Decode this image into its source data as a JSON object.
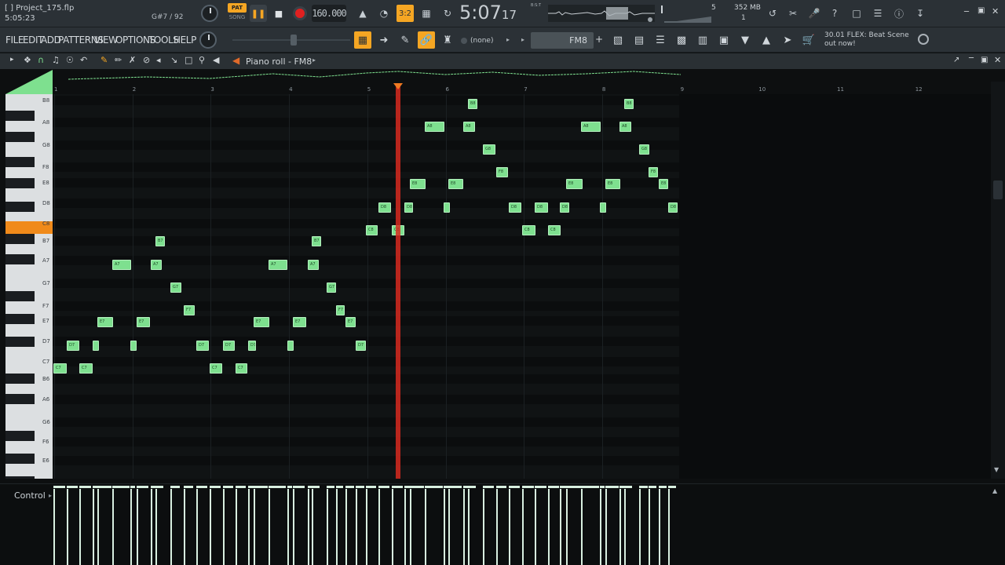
{
  "window": {
    "project_file": "[ ] Project_175.flp",
    "elapsed": "5:05:23",
    "note_info": "G#7 / 92"
  },
  "transport": {
    "pat_label": "PAT",
    "song_label": "SONG",
    "tempo": "160.000",
    "time_main": "5:07",
    "time_sub": "17",
    "time_unit": "B:S:T",
    "snap_label": "3:2",
    "cpu_voices": "5",
    "memory": "352 MB",
    "poly": "1"
  },
  "menu": [
    "FILE",
    "EDIT",
    "ADD",
    "PATTERNS",
    "VIEW",
    "OPTIONS",
    "TOOLS",
    "HELP"
  ],
  "toolbar": {
    "pattern_select": "(none)",
    "channel_name": "FM8",
    "news_line1": "30.01  FLEX: Beat Scene",
    "news_line2": "out now!"
  },
  "piano_roll": {
    "title": "Piano roll - FM8",
    "control_label": "Control",
    "bar_numbers": [
      "1",
      "2",
      "3",
      "4",
      "5",
      "6",
      "7",
      "8",
      "9",
      "10",
      "11",
      "12"
    ],
    "key_labels": [
      "B8",
      "A8",
      "G8",
      "F8",
      "E8",
      "D8",
      "C8",
      "B7",
      "A7",
      "G7",
      "F7",
      "E7",
      "D7",
      "C7",
      "B6",
      "A6",
      "G6",
      "F6",
      "E6"
    ],
    "notes": [
      {
        "label": "C7"
      },
      {
        "label": "C7"
      },
      {
        "label": "D7"
      },
      {
        "label": ""
      },
      {
        "label": "E7"
      },
      {
        "label": "A7"
      },
      {
        "label": "E7"
      },
      {
        "label": ""
      },
      {
        "label": "B7"
      },
      {
        "label": "A7"
      },
      {
        "label": "G7"
      },
      {
        "label": "F7"
      },
      {
        "label": "D7"
      },
      {
        "label": "C7"
      },
      {
        "label": "D7"
      },
      {
        "label": "C7"
      },
      {
        "label": "D7"
      },
      {
        "label": "E7"
      },
      {
        "label": "A7"
      },
      {
        "label": ""
      },
      {
        "label": "E7"
      },
      {
        "label": "A7"
      },
      {
        "label": "B7"
      },
      {
        "label": "G7"
      },
      {
        "label": "F7"
      },
      {
        "label": "E7"
      },
      {
        "label": "D7"
      },
      {
        "label": "C8"
      },
      {
        "label": "D8"
      },
      {
        "label": "C8"
      },
      {
        "label": "D8"
      },
      {
        "label": "E8"
      },
      {
        "label": "A8"
      },
      {
        "label": ""
      },
      {
        "label": "E8"
      },
      {
        "label": "A8"
      },
      {
        "label": "B8"
      },
      {
        "label": "G8"
      },
      {
        "label": "F8"
      },
      {
        "label": "D8"
      },
      {
        "label": "C8"
      },
      {
        "label": "D8"
      },
      {
        "label": "C8"
      },
      {
        "label": "D8"
      },
      {
        "label": "E8"
      },
      {
        "label": "A8"
      },
      {
        "label": ""
      },
      {
        "label": "E8"
      },
      {
        "label": "A8"
      },
      {
        "label": "B8"
      },
      {
        "label": "G8"
      },
      {
        "label": "F8"
      },
      {
        "label": "E8"
      },
      {
        "label": "D8"
      }
    ]
  },
  "colors": {
    "accent": "#f5a623",
    "note_fill": "#7ee08f",
    "playhead": "#d72a1f"
  }
}
